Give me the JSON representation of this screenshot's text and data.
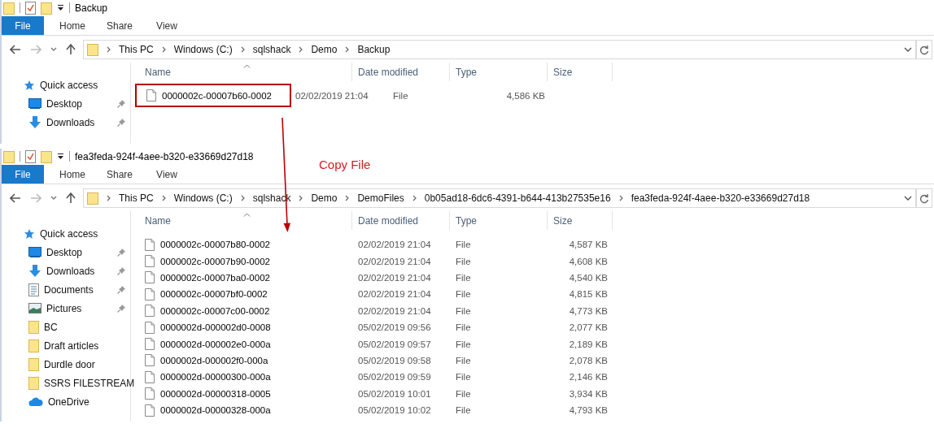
{
  "windows": [
    {
      "title": "Backup",
      "ribbon_tabs": [
        {
          "label": "File",
          "selected": true
        },
        {
          "label": "Home",
          "selected": false
        },
        {
          "label": "Share",
          "selected": false
        },
        {
          "label": "View",
          "selected": false
        }
      ],
      "breadcrumb": [
        "This PC",
        "Windows (C:)",
        "sqlshack",
        "Demo",
        "Backup"
      ],
      "nav_pane": [
        {
          "label": "Quick access",
          "kind": "star",
          "pinned": false
        },
        {
          "label": "Desktop",
          "kind": "desktop",
          "pinned": true
        },
        {
          "label": "Downloads",
          "kind": "downloads",
          "pinned": true
        }
      ],
      "columns": [
        {
          "label": "Name",
          "sorted": true
        },
        {
          "label": "Date modified",
          "sorted": false
        },
        {
          "label": "Type",
          "sorted": false
        },
        {
          "label": "Size",
          "sorted": false
        }
      ],
      "files": [
        {
          "name": "0000002c-00007b60-0002",
          "date": "02/02/2019 21:04",
          "type": "File",
          "size": "4,586 KB",
          "outlined": true
        }
      ]
    },
    {
      "title": "fea3feda-924f-4aee-b320-e33669d27d18",
      "ribbon_tabs": [
        {
          "label": "File",
          "selected": true
        },
        {
          "label": "Home",
          "selected": false
        },
        {
          "label": "Share",
          "selected": false
        },
        {
          "label": "View",
          "selected": false
        }
      ],
      "breadcrumb": [
        "This PC",
        "Windows (C:)",
        "sqlshack",
        "Demo",
        "DemoFiles",
        "0b05ad18-6dc6-4391-b644-413b27535e16",
        "fea3feda-924f-4aee-b320-e33669d27d18"
      ],
      "nav_pane": [
        {
          "label": "Quick access",
          "kind": "star",
          "pinned": false
        },
        {
          "label": "Desktop",
          "kind": "desktop",
          "pinned": true
        },
        {
          "label": "Downloads",
          "kind": "downloads",
          "pinned": true
        },
        {
          "label": "Documents",
          "kind": "documents",
          "pinned": true
        },
        {
          "label": "Pictures",
          "kind": "pictures",
          "pinned": true
        },
        {
          "label": "BC",
          "kind": "folder",
          "pinned": false
        },
        {
          "label": "Draft articles",
          "kind": "folder",
          "pinned": false
        },
        {
          "label": "Durdle door",
          "kind": "folder",
          "pinned": false
        },
        {
          "label": "SSRS FILESTREAM",
          "kind": "folder",
          "pinned": false
        },
        {
          "label": "OneDrive",
          "kind": "cloud",
          "pinned": false
        }
      ],
      "columns": [
        {
          "label": "Name",
          "sorted": true
        },
        {
          "label": "Date modified",
          "sorted": false
        },
        {
          "label": "Type",
          "sorted": false
        },
        {
          "label": "Size",
          "sorted": false
        }
      ],
      "files": [
        {
          "name": "0000002c-00007b80-0002",
          "date": "02/02/2019 21:04",
          "type": "File",
          "size": "4,587 KB",
          "outlined": false
        },
        {
          "name": "0000002c-00007b90-0002",
          "date": "02/02/2019 21:04",
          "type": "File",
          "size": "4,608 KB",
          "outlined": false
        },
        {
          "name": "0000002c-00007ba0-0002",
          "date": "02/02/2019 21:04",
          "type": "File",
          "size": "4,540 KB",
          "outlined": false
        },
        {
          "name": "0000002c-00007bf0-0002",
          "date": "02/02/2019 21:04",
          "type": "File",
          "size": "4,815 KB",
          "outlined": false
        },
        {
          "name": "0000002c-00007c00-0002",
          "date": "02/02/2019 21:04",
          "type": "File",
          "size": "4,773 KB",
          "outlined": false
        },
        {
          "name": "0000002d-000002d0-0008",
          "date": "05/02/2019 09:56",
          "type": "File",
          "size": "2,077 KB",
          "outlined": false
        },
        {
          "name": "0000002d-000002e0-000a",
          "date": "05/02/2019 09:57",
          "type": "File",
          "size": "2,189 KB",
          "outlined": false
        },
        {
          "name": "0000002d-000002f0-000a",
          "date": "05/02/2019 09:58",
          "type": "File",
          "size": "2,078 KB",
          "outlined": false
        },
        {
          "name": "0000002d-00000300-000a",
          "date": "05/02/2019 09:59",
          "type": "File",
          "size": "2,146 KB",
          "outlined": false
        },
        {
          "name": "0000002d-00000318-0005",
          "date": "05/02/2019 10:01",
          "type": "File",
          "size": "3,934 KB",
          "outlined": false
        },
        {
          "name": "0000002d-00000328-000a",
          "date": "05/02/2019 10:02",
          "type": "File",
          "size": "4,793 KB",
          "outlined": false
        }
      ]
    }
  ],
  "annotation": {
    "label": "Copy File"
  }
}
